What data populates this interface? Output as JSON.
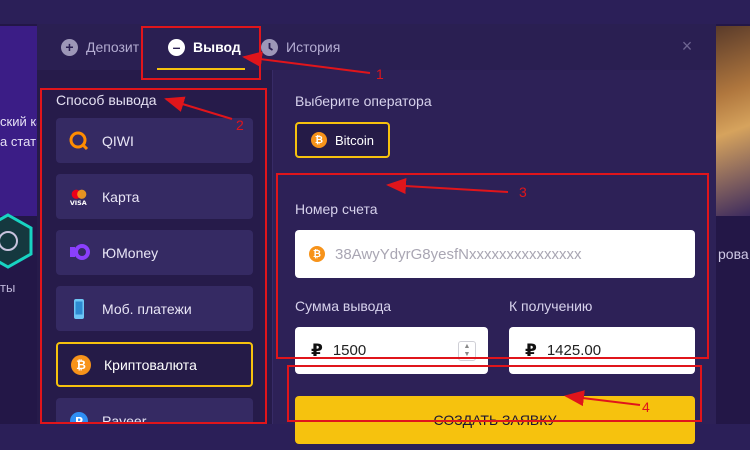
{
  "background": {
    "left_text_lines": [
      "ский ка",
      "а стат"
    ],
    "left_label": "ты",
    "right_text": "рова"
  },
  "tabs": {
    "deposit": "Депозит",
    "withdraw": "Вывод",
    "history": "История",
    "close_icon": "×"
  },
  "withdraw_methods": {
    "title": "Способ вывода",
    "items": [
      {
        "label": "QIWI",
        "icon": "qiwi-icon"
      },
      {
        "label": "Карта",
        "icon": "visa-card-icon"
      },
      {
        "label": "ЮMoney",
        "icon": "yumoney-icon"
      },
      {
        "label": "Моб. платежи",
        "icon": "mobile-phone-icon"
      },
      {
        "label": "Криптовалюта",
        "icon": "bitcoin-icon",
        "selected": true
      },
      {
        "label": "Payeer",
        "icon": "payeer-icon"
      }
    ]
  },
  "operator": {
    "label": "Выберите оператора",
    "selected": "Bitcoin"
  },
  "account": {
    "label": "Номер счета",
    "placeholder": "38AwyYdyrG8yesfNxxxxxxxxxxxxxxx"
  },
  "amount": {
    "label": "Сумма вывода",
    "currency_symbol": "₽",
    "value": "1500"
  },
  "receive": {
    "label": "К получению",
    "currency_symbol": "₽",
    "value": "1425.00"
  },
  "submit_label": "СОЗДАТЬ ЗАЯВКУ",
  "annotations": [
    "1",
    "2",
    "3",
    "4"
  ],
  "colors": {
    "accent": "#f6c20e",
    "annotation": "#e0151b",
    "modal_bg": "#2d2157"
  }
}
